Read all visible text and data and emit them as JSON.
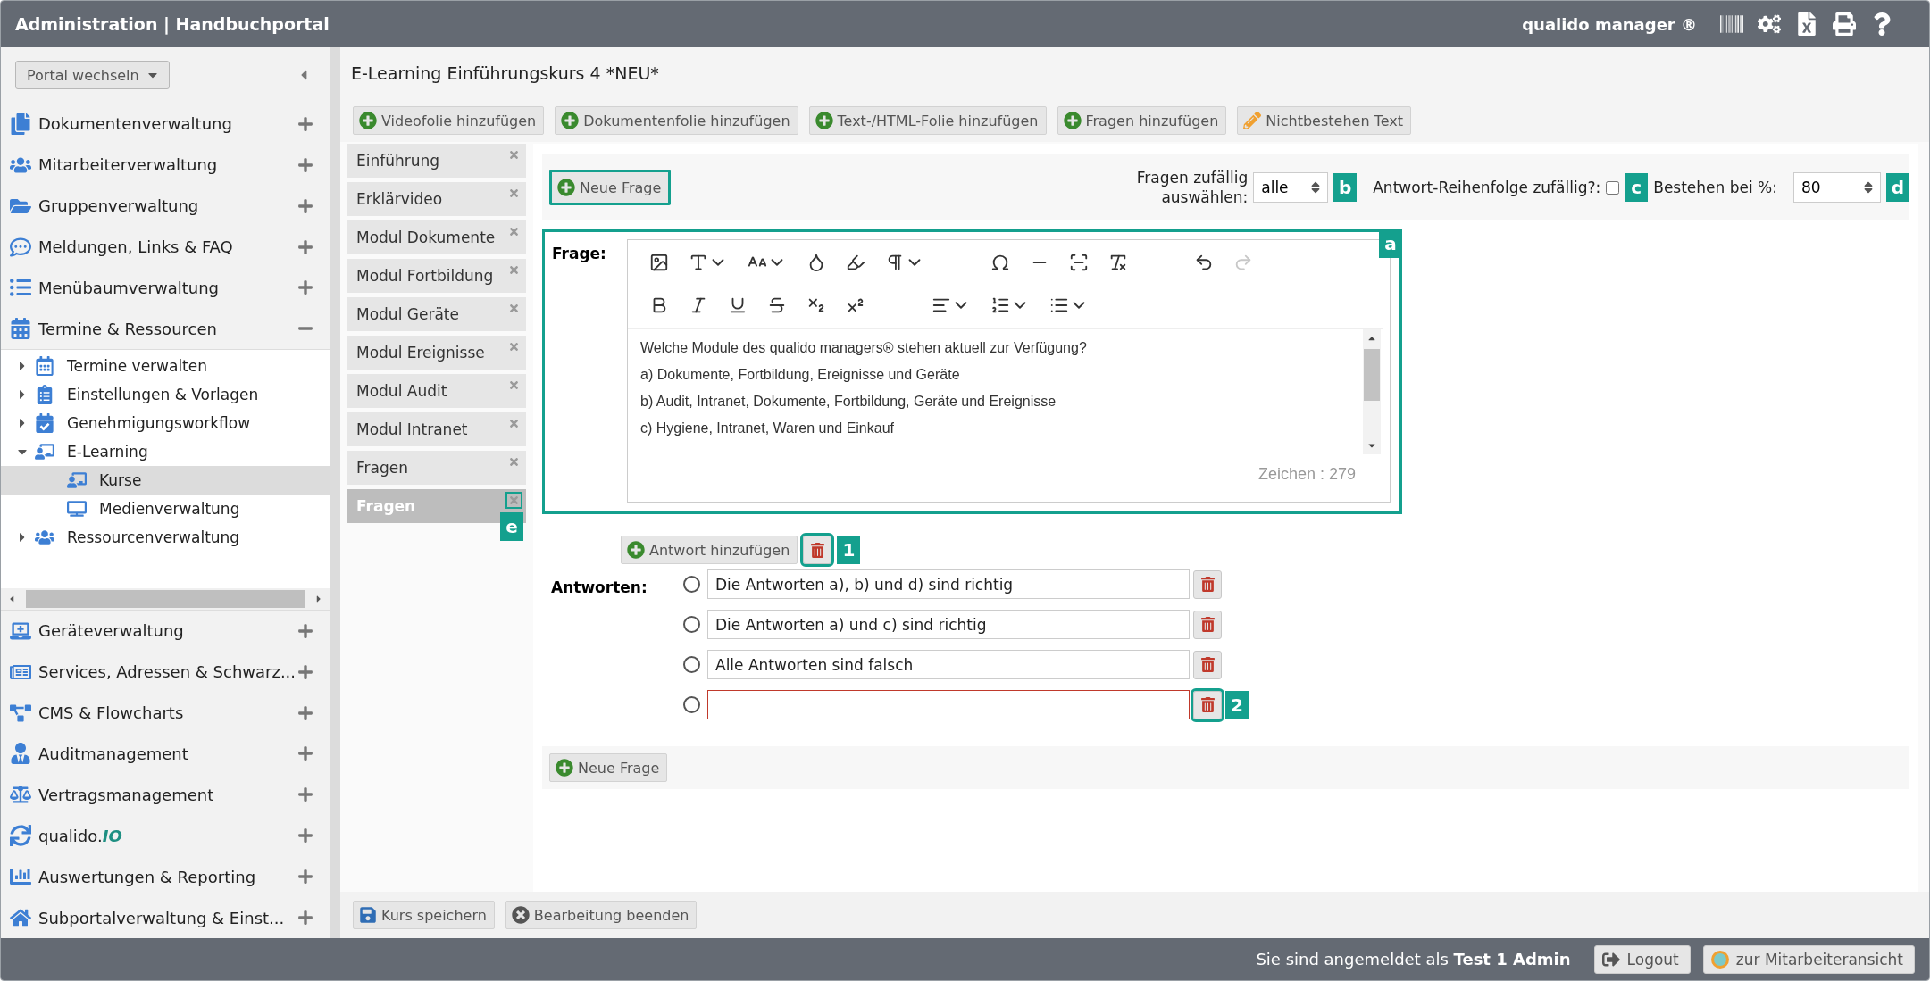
{
  "header": {
    "title": "Administration | Handbuchportal",
    "brand": "qualido manager ®"
  },
  "sidebar": {
    "portal_switch": "Portal wechseln",
    "groups_top": [
      {
        "label": "Dokumentenverwaltung",
        "expanded": false
      },
      {
        "label": "Mitarbeiterverwaltung",
        "expanded": false
      },
      {
        "label": "Gruppenverwaltung",
        "expanded": false
      },
      {
        "label": "Meldungen, Links & FAQ",
        "expanded": false
      },
      {
        "label": "Menübaumverwaltung",
        "expanded": false
      },
      {
        "label": "Termine & Ressourcen",
        "expanded": true
      }
    ],
    "tree": [
      {
        "label": "Termine verwalten",
        "expanded": false,
        "selected": false
      },
      {
        "label": "Einstellungen & Vorlagen",
        "expanded": false,
        "selected": false
      },
      {
        "label": "Genehmigungsworkflow",
        "expanded": false,
        "selected": false
      },
      {
        "label": "E-Learning",
        "expanded": true,
        "selected": false,
        "children": [
          {
            "label": "Kurse",
            "selected": true
          },
          {
            "label": "Medienverwaltung",
            "selected": false
          }
        ]
      },
      {
        "label": "Ressourcenverwaltung",
        "expanded": false,
        "selected": false
      }
    ],
    "groups_bottom": [
      {
        "label": "Geräteverwaltung",
        "expanded": false
      },
      {
        "label": "Services, Adressen & Schwarz...",
        "expanded": false
      },
      {
        "label": "CMS & Flowcharts",
        "expanded": false
      },
      {
        "label": "Auditmanagement",
        "expanded": false
      },
      {
        "label": "Vertragsmanagement",
        "expanded": false
      },
      {
        "label": "qualido.*IO*",
        "expanded": false
      },
      {
        "label": "Auswertungen & Reporting",
        "expanded": false
      },
      {
        "label": "Subportalverwaltung & Einst...",
        "expanded": false
      }
    ]
  },
  "course_title": "E-Learning Einführungskurs 4 *NEU*",
  "toolbar": [
    {
      "label": "Videofolie hinzufügen",
      "kind": "add"
    },
    {
      "label": "Dokumentenfolie hinzufügen",
      "kind": "add"
    },
    {
      "label": "Text-/HTML-Folie hinzufügen",
      "kind": "add"
    },
    {
      "label": "Fragen hinzufügen",
      "kind": "add"
    },
    {
      "label": "Nichtbestehen Text",
      "kind": "edit"
    }
  ],
  "slides": [
    {
      "label": "Einführung",
      "selected": false
    },
    {
      "label": "Erklärvideo",
      "selected": false
    },
    {
      "label": "Modul Dokumente",
      "selected": false
    },
    {
      "label": "Modul Fortbildung",
      "selected": false
    },
    {
      "label": "Modul Geräte",
      "selected": false
    },
    {
      "label": "Modul Ereignisse",
      "selected": false
    },
    {
      "label": "Modul Audit",
      "selected": false
    },
    {
      "label": "Modul Intranet",
      "selected": false
    },
    {
      "label": "Fragen",
      "selected": false
    },
    {
      "label": "Fragen",
      "selected": true,
      "marker": "e"
    }
  ],
  "new_question_top": {
    "label": "Neue Frage",
    "highlighted": true
  },
  "settings": {
    "random_questions": {
      "label": "Fragen zufällig auswählen:",
      "value": "alle",
      "marker": "b"
    },
    "random_order": {
      "label": "Antwort-Reihenfolge zufällig?:",
      "checked": false,
      "marker": "c"
    },
    "pass_percent": {
      "label": "Bestehen bei %:",
      "value": "80",
      "marker": "d"
    }
  },
  "question": {
    "label": "Frage:",
    "marker": "a",
    "lines": [
      "Welche Module des qualido managers® stehen aktuell zur Verfügung?",
      "a) Dokumente, Fortbildung, Ereignisse und Geräte",
      "b) Audit, Intranet, Dokumente, Fortbildung, Geräte und Ereignisse",
      "c) Hygiene, Intranet, Waren und Einkauf"
    ],
    "char_count": "Zeichen : 279"
  },
  "answers": {
    "add_label": "Antwort hinzufügen",
    "delete_marker": "1",
    "label": "Antworten:",
    "items": [
      {
        "text": "Die Antworten a), b) und d) sind richtig",
        "selected": false,
        "invalid": false
      },
      {
        "text": "Die Antworten a) und c) sind richtig",
        "selected": false,
        "invalid": false
      },
      {
        "text": "Alle Antworten sind falsch",
        "selected": false,
        "invalid": false
      },
      {
        "selected": false,
        "invalid": true,
        "marker": "2"
      }
    ]
  },
  "new_question_bottom": {
    "label": "Neue Frage",
    "highlighted": false
  },
  "footer_buttons": [
    {
      "label": "Kurs speichern",
      "kind": "save"
    },
    {
      "label": "Bearbeitung beenden",
      "kind": "cancel"
    }
  ],
  "status_bar": {
    "login": "Sie sind angemeldet als **Test 1 Admin**",
    "logout": "Logout",
    "employee_view": "zur Mitarbeiteransicht"
  }
}
